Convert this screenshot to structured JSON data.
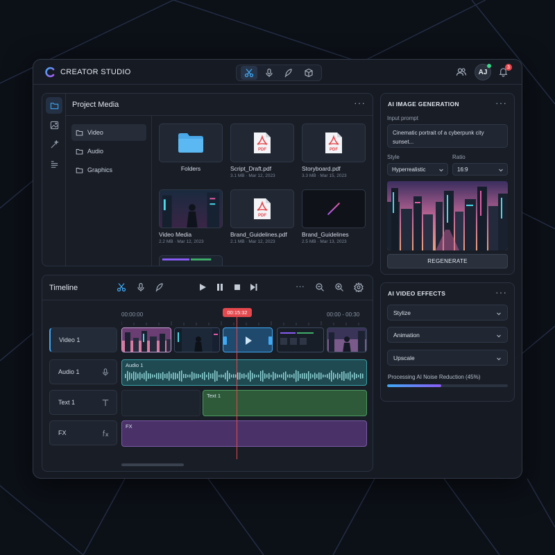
{
  "app": {
    "title": "CREATOR STUDIO",
    "accent": "#3fa9f5",
    "logo_icon": "c-logo-icon",
    "top_tools": [
      {
        "icon": "scissors-icon",
        "active": true
      },
      {
        "icon": "microphone-icon",
        "active": false
      },
      {
        "icon": "magic-pen-icon",
        "active": false
      },
      {
        "icon": "cube-icon",
        "active": false
      }
    ],
    "avatar_initials": "AJ",
    "notification_count": "3"
  },
  "media": {
    "title": "Project Media",
    "more": "···",
    "rail": [
      "folder-icon",
      "image-icon",
      "magic-wand-icon",
      "text-lines-icon"
    ],
    "folders": [
      {
        "label": "Video",
        "active": true
      },
      {
        "label": "Audio",
        "active": false
      },
      {
        "label": "Graphics",
        "active": false
      }
    ],
    "tiles": [
      {
        "name": "Folders",
        "meta": "",
        "kind": "folder"
      },
      {
        "name": "Script_Draft.pdf",
        "meta": "3.1 MB · Mar 12, 2023",
        "kind": "pdf"
      },
      {
        "name": "Storyboard.pdf",
        "meta": "3.3 MB · Mar 15, 2023",
        "kind": "pdf"
      },
      {
        "name": "Video Media",
        "meta": "2.2 MB · Mar 12, 2023",
        "kind": "video"
      },
      {
        "name": "Brand_Guidelines.pdf",
        "meta": "2.1 MB · Mar 12, 2023",
        "kind": "pdf"
      },
      {
        "name": "Brand_Guidelines",
        "meta": "2.5 MB · Mar 13, 2023",
        "kind": "graphic"
      }
    ],
    "pdf_label": "PDF"
  },
  "ai_image": {
    "title": "AI IMAGE GENERATION",
    "more": "···",
    "prompt_label": "Input prompt",
    "prompt_value": "Cinematic portrait of a cyberpunk city sunset...",
    "style_label": "Style",
    "style_value": "Hyperrealistic",
    "ratio_label": "Ratio",
    "ratio_value": "16:9",
    "regenerate_label": "REGENERATE"
  },
  "ai_video": {
    "title": "AI VIDEO EFFECTS",
    "more": "···",
    "effects": [
      "Stylize",
      "Animation",
      "Upscale"
    ],
    "progress_label": "Processing AI Noise Reduction (45%)",
    "progress": 0.45
  },
  "timeline": {
    "title": "Timeline",
    "start_time": "00:00:00",
    "playhead_time": "00:15:32",
    "range": "00:00 - 00:30",
    "tracks": [
      {
        "label": "Video 1",
        "icon": "",
        "active": true
      },
      {
        "label": "Audio 1",
        "icon": "microphone-icon",
        "active": false
      },
      {
        "label": "Text 1",
        "icon": "text-t-icon",
        "active": false
      },
      {
        "label": "FX",
        "icon": "fx-icon",
        "active": false
      }
    ],
    "clips": {
      "audio": "Audio 1",
      "text": "Text 1",
      "fx": "FX"
    }
  }
}
